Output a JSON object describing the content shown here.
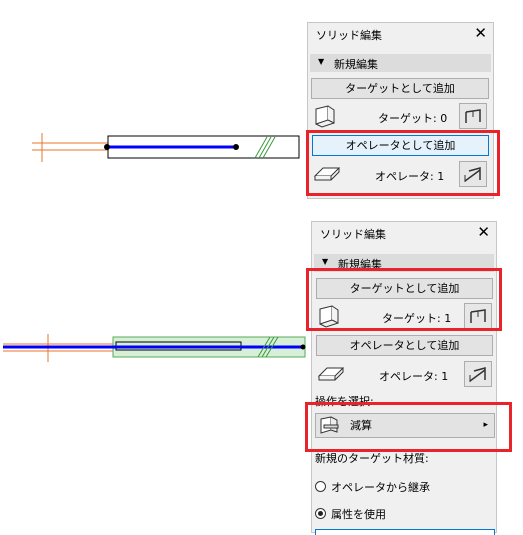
{
  "panel1": {
    "title": "ソリッド編集",
    "close_glyph": "✕",
    "section_title": "新規編集",
    "add_target_label": "ターゲットとして追加",
    "target_count": "ターゲット: 0",
    "add_operator_label": "オペレータとして追加",
    "operator_count": "オペレータ: 1"
  },
  "panel2": {
    "title": "ソリッド編集",
    "close_glyph": "✕",
    "section_title": "新規編集",
    "add_target_label": "ターゲットとして追加",
    "target_count": "ターゲット: 1",
    "add_operator_label": "オペレータとして追加",
    "operator_count": "オペレータ: 1",
    "operation_header": "操作を選択:",
    "operation_value": "減算",
    "operation_arrow": "▸",
    "material_header": "新規のターゲット材質:",
    "radio_options": [
      {
        "label": "オペレータから継承",
        "selected": false
      },
      {
        "label": "属性を使用",
        "selected": true
      }
    ]
  },
  "colors": {
    "highlight_red": "#e8232a",
    "wall_blue": "#0000ff",
    "selection_green": "#5aaa5a",
    "axis_orange": "#e8742a"
  },
  "icons": [
    "target-element-icon",
    "target-select-icon",
    "operator-element-icon",
    "operator-select-icon",
    "subtract-operation-icon"
  ]
}
